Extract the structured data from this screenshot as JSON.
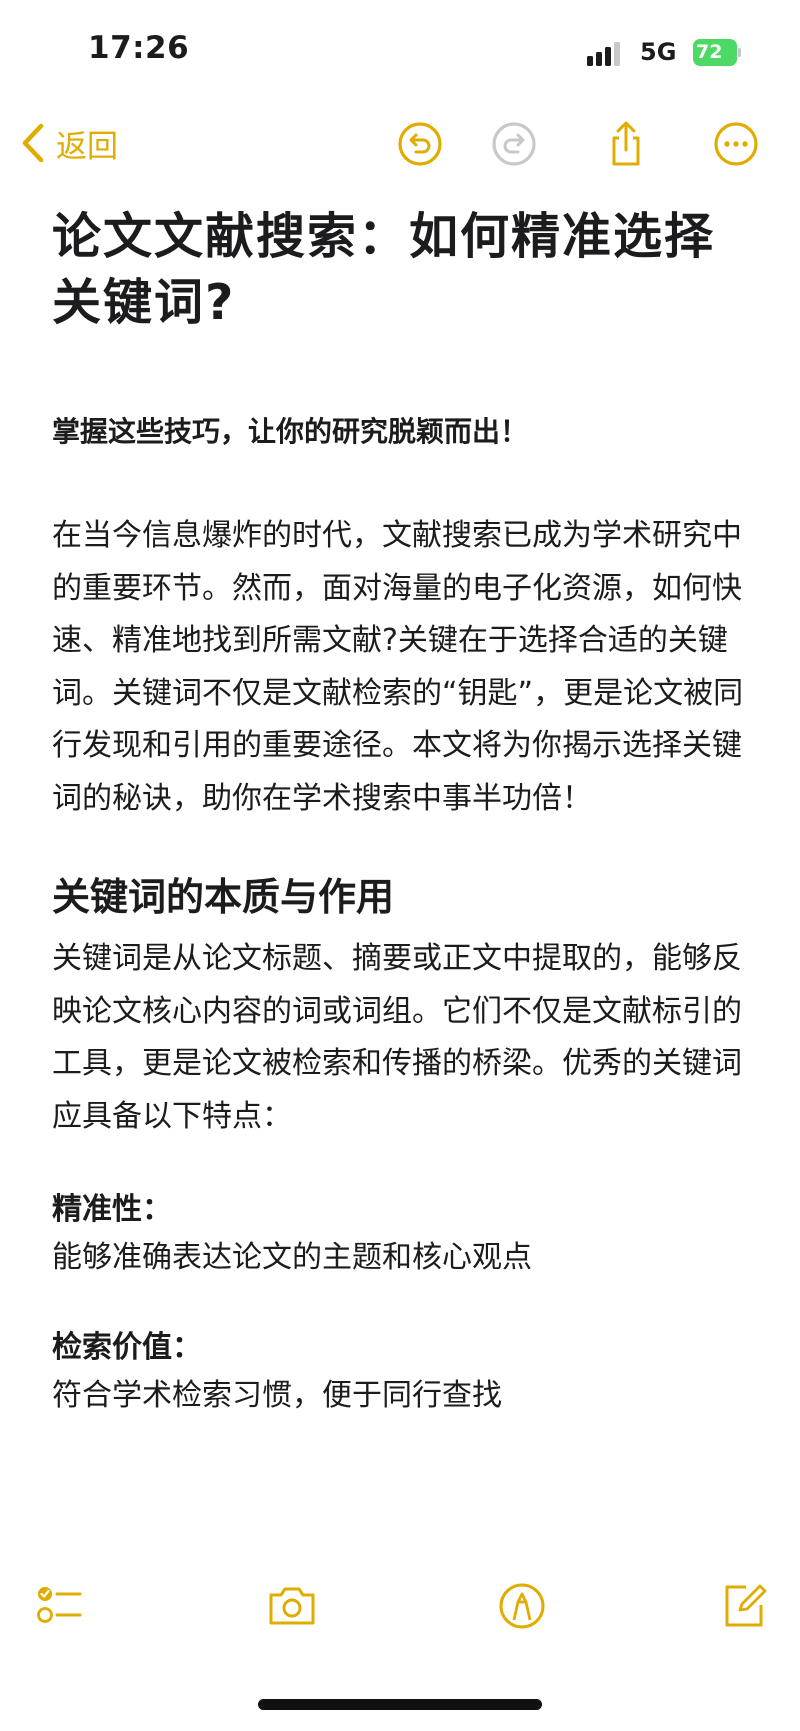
{
  "status": {
    "time": "17:26",
    "network": "5G",
    "battery": "72"
  },
  "toolbar": {
    "back_label": "返回",
    "icons": [
      "chevron-left-icon",
      "undo-icon",
      "redo-icon",
      "share-icon",
      "more-icon"
    ]
  },
  "note": {
    "title": "论文文献搜索：如何精准选择关键词?",
    "subtitle": "掌握这些技巧，让你的研究脱颖而出！",
    "intro": "在当今信息爆炸的时代，文献搜索已成为学术研究中的重要环节。然而，面对海量的电子化资源，如何快速、精准地找到所需文献?关键在于选择合适的关键词。关键词不仅是文献检索的“钥匙”，更是论文被同行发现和引用的重要途径。本文将为你揭示选择关键词的秘诀，助你在学术搜索中事半功倍！",
    "section_heading": "关键词的本质与作用",
    "section_body": "关键词是从论文标题、摘要或正文中提取的，能够反映论文核心内容的词或词组。它们不仅是文献标引的工具，更是论文被检索和传播的桥梁。优秀的关键词应具备以下特点：",
    "features": [
      {
        "term": "精准性：",
        "desc": "能够准确表达论文的主题和核心观点"
      },
      {
        "term": "检索价值：",
        "desc": "符合学术检索习惯，便于同行查找"
      }
    ]
  },
  "bottom_bar": {
    "icons": [
      "checklist-icon",
      "camera-icon",
      "markup-pen-icon",
      "compose-icon"
    ]
  },
  "colors": {
    "accent": "#e0ac00",
    "text": "#1c1c1e",
    "battery": "#4cd964",
    "disabled": "#c7c7cc"
  }
}
